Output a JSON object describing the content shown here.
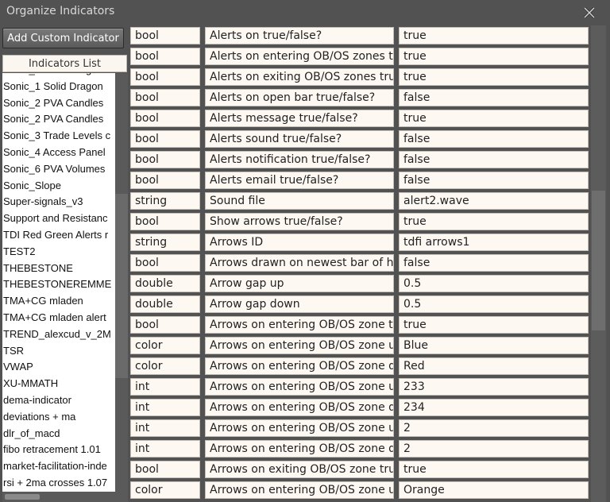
{
  "window": {
    "title": "Organize Indicators"
  },
  "toolbar": {
    "add_label": "Add Custom Indicator"
  },
  "indicators": {
    "header": "Indicators List",
    "partial_top": "Sonic_1 Solid Dragon",
    "items": [
      "Sonic_1 Solid Dragon",
      "Sonic_2 PVA Candles",
      "Sonic_2 PVA Candles",
      "Sonic_3 Trade Levels c",
      "Sonic_4 Access Panel",
      "Sonic_6 PVA Volumes",
      "Sonic_Slope",
      "Super-signals_v3",
      "Support and Resistanc",
      "TDI Red Green Alerts r",
      "TEST2",
      "THEBESTONE",
      "THEBESTONEREMME",
      "TMA+CG mladen",
      "TMA+CG mladen alert",
      "TREND_alexcud_v_2M",
      "TSR",
      "VWAP",
      "XU-MMATH",
      "dema-indicator",
      "deviations + ma",
      "dlr_of_macd",
      "fibo retracement 1.01",
      "market-facilitation-inde",
      "rsi + 2ma crosses 1.07"
    ]
  },
  "params": [
    {
      "type": "bool",
      "name": "Alerts on true/false?",
      "value": "true"
    },
    {
      "type": "bool",
      "name": "Alerts on entering OB/OS zones tru",
      "value": "true"
    },
    {
      "type": "bool",
      "name": "Alerts on exiting OB/OS zones true/",
      "value": "true"
    },
    {
      "type": "bool",
      "name": "Alerts on open bar true/false?",
      "value": "false"
    },
    {
      "type": "bool",
      "name": "Alerts message true/false?",
      "value": "true"
    },
    {
      "type": "bool",
      "name": "Alerts sound true/false?",
      "value": "false"
    },
    {
      "type": "bool",
      "name": "Alerts notification true/false?",
      "value": "false"
    },
    {
      "type": "bool",
      "name": "Alerts email true/false?",
      "value": "false"
    },
    {
      "type": "string",
      "name": "Sound file",
      "value": "alert2.wave"
    },
    {
      "type": "bool",
      "name": "Show arrows true/false?",
      "value": "true"
    },
    {
      "type": "string",
      "name": "Arrows ID",
      "value": "tdfi arrows1"
    },
    {
      "type": "bool",
      "name": "Arrows drawn on newest bar of hig",
      "value": "false"
    },
    {
      "type": "double",
      "name": "Arrow gap up",
      "value": "0.5"
    },
    {
      "type": "double",
      "name": "Arrow gap down",
      "value": "0.5"
    },
    {
      "type": "bool",
      "name": "Arrows on entering OB/OS zone tru",
      "value": "true"
    },
    {
      "type": "color",
      "name": "Arrows on entering OB/OS zone up",
      "value": "Blue"
    },
    {
      "type": "color",
      "name": "Arrows on entering OB/OS zone do",
      "value": "Red"
    },
    {
      "type": "int",
      "name": "Arrows on entering OB/OS zone up",
      "value": "233"
    },
    {
      "type": "int",
      "name": "Arrows on entering OB/OS zone do",
      "value": "234"
    },
    {
      "type": "int",
      "name": "Arrows on entering OB/OS zone up",
      "value": "2"
    },
    {
      "type": "int",
      "name": "Arrows on entering OB/OS zone do",
      "value": "2"
    },
    {
      "type": "bool",
      "name": "Arrows on exiting OB/OS zone true",
      "value": "true"
    },
    {
      "type": "color",
      "name": "Arrows on entering OB/OS zone up",
      "value": "Orange"
    }
  ],
  "icons": {
    "close": "close-icon"
  },
  "colors": {
    "background": "#525252",
    "cell": "#fdf8f2",
    "button": "#6a6a6a"
  }
}
